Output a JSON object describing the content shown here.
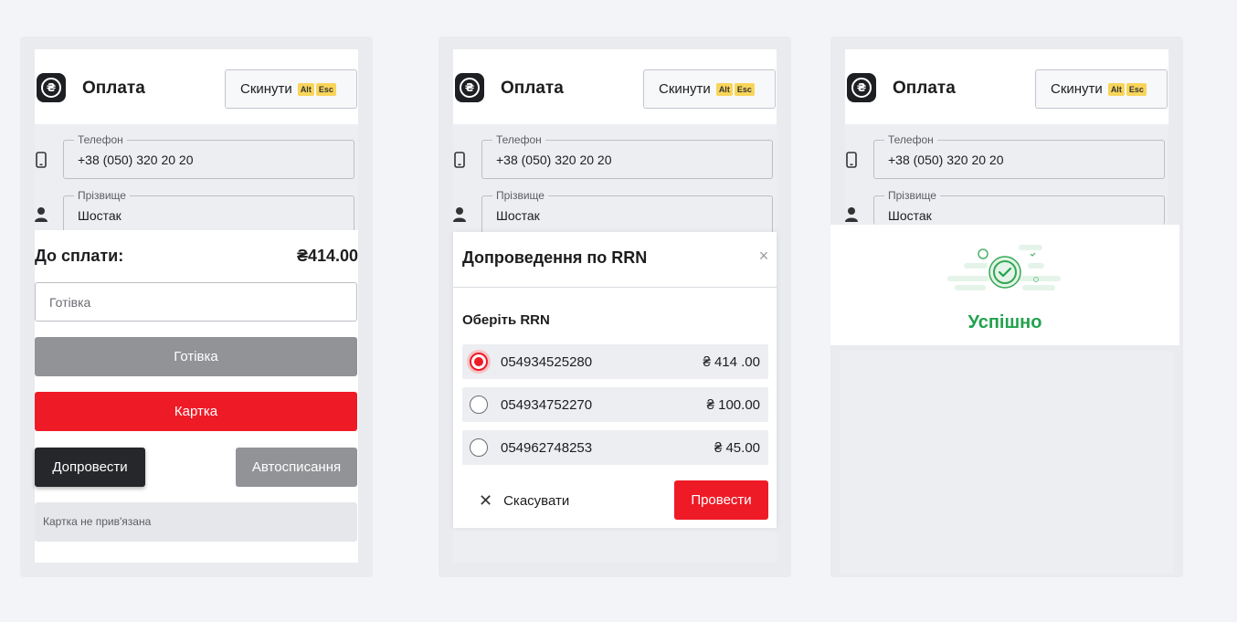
{
  "header": {
    "title": "Оплата",
    "reset_label": "Скинути",
    "kbd_alt": "Alt",
    "kbd_esc": "Esc",
    "logo_symbol": "₴"
  },
  "form": {
    "phone_label": "Телефон",
    "phone_value": "+38 (050) 320 20 20",
    "surname_label": "Прізвище",
    "surname_value": "Шостак"
  },
  "payment": {
    "due_label": "До сплати:",
    "due_value": "₴414.00",
    "cash_placeholder": "Готівка",
    "cash_button": "Готівка",
    "card_button": "Картка",
    "finish_button": "Допровести",
    "auto_button": "Автосписання",
    "card_note": "Картка не прив'язана"
  },
  "rrn_modal": {
    "title": "Допроведення по RRN",
    "close_symbol": "×",
    "subtitle": "Оберіть RRN",
    "options": [
      {
        "rrn": "054934525280",
        "amount": "₴ 414 .00",
        "selected": true
      },
      {
        "rrn": "054934752270",
        "amount": "₴ 100.00",
        "selected": false
      },
      {
        "rrn": "054962748253",
        "amount": "₴ 45.00",
        "selected": false
      }
    ],
    "cancel_label": "Скасувати",
    "submit_label": "Провести"
  },
  "success": {
    "text": "Успішно"
  },
  "colors": {
    "accent_red": "#ee1b27",
    "success_green": "#22a24e",
    "dark": "#26272b",
    "gray_button": "#929397"
  }
}
